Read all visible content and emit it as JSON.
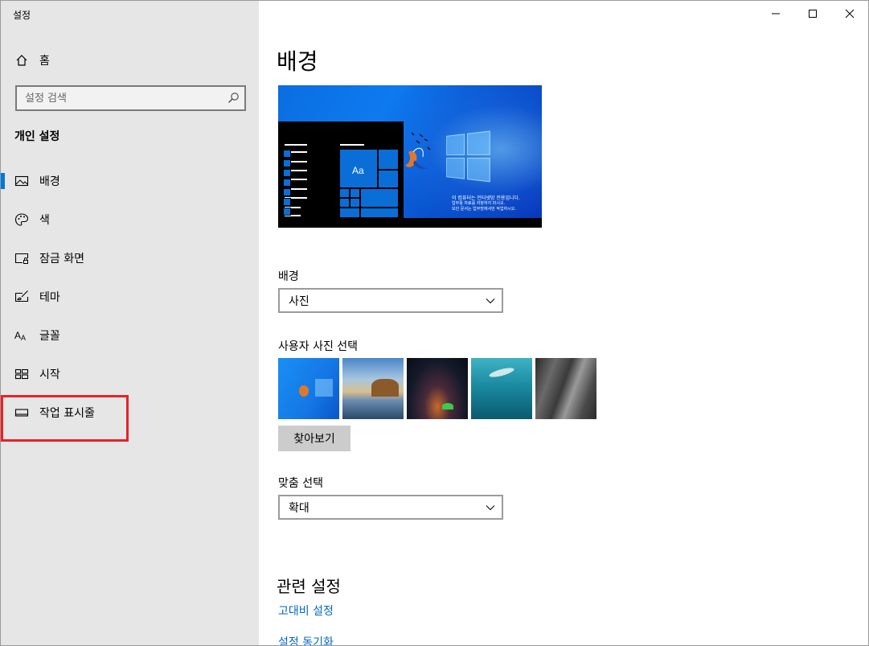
{
  "window": {
    "app_title": "설정",
    "controls": {
      "minimize": "minimize",
      "maximize": "maximize",
      "close": "close"
    }
  },
  "sidebar": {
    "home_label": "홈",
    "search_placeholder": "설정 검색",
    "section_title": "개인 설정",
    "items": [
      {
        "label": "배경",
        "icon": "picture-icon",
        "active": true
      },
      {
        "label": "색",
        "icon": "palette-icon"
      },
      {
        "label": "잠금 화면",
        "icon": "lock-screen-icon"
      },
      {
        "label": "테마",
        "icon": "theme-brush-icon"
      },
      {
        "label": "글꼴",
        "icon": "font-icon"
      },
      {
        "label": "시작",
        "icon": "start-icon"
      },
      {
        "label": "작업 표시줄",
        "icon": "taskbar-icon",
        "highlighted": true
      }
    ],
    "highlight_color": "#e8202a",
    "accent_color": "#0078d7"
  },
  "main": {
    "title": "배경",
    "preview": {
      "tile_text": "Aa",
      "caption_lines": [
        "이 컴퓨터는 인터넷망 전용입니다.",
        "업무용 자료를 저장하지 마시오.",
        "보안 문서는 업무망에서만 작업하시오."
      ]
    },
    "background_label": "배경",
    "background_value": "사진",
    "choose_picture_label": "사용자 사진 선택",
    "thumbnails": [
      "windows-hero",
      "beach-rocks",
      "night-sky",
      "underwater-swimmer",
      "cliff-face"
    ],
    "browse_label": "찾아보기",
    "fit_label": "맞춤 선택",
    "fit_value": "확대",
    "related_title": "관련 설정",
    "links": [
      "고대비 설정",
      "설정 동기화"
    ],
    "link_color": "#0067c0"
  }
}
